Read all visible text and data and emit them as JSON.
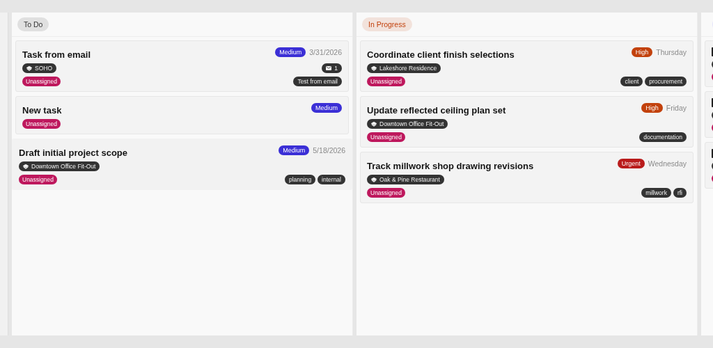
{
  "columns": [
    {
      "title": "To Do",
      "color": "#333333",
      "cards": [
        {
          "title": "Task from email",
          "hovered": false,
          "priority": {
            "label": "Medium",
            "color": "#3b2fd6"
          },
          "due": "3/31/2026",
          "project": "SOHO",
          "email_count": "1",
          "assignee": "Unassigned",
          "tags": [
            "Test from email"
          ]
        },
        {
          "title": "New task",
          "hovered": false,
          "priority": {
            "label": "Medium",
            "color": "#3b2fd6"
          },
          "assignee": "Unassigned"
        },
        {
          "title": "Draft initial project scope",
          "hovered": true,
          "priority": {
            "label": "Medium",
            "color": "#3b2fd6"
          },
          "due": "5/18/2026",
          "project": "Downtown Office Fit-Out",
          "assignee": "Unassigned",
          "tags": [
            "planning",
            "internal"
          ]
        }
      ]
    },
    {
      "title": "In Progress",
      "color": "#c2410c",
      "cards": [
        {
          "title": "Coordinate client finish selections",
          "hovered": false,
          "priority": {
            "label": "High",
            "color": "#c2410c"
          },
          "due": "Thursday",
          "project": "Lakeshore Residence",
          "assignee": "Unassigned",
          "tags": [
            "client",
            "procurement"
          ]
        },
        {
          "title": "Update reflected ceiling plan set",
          "hovered": false,
          "priority": {
            "label": "High",
            "color": "#c2410c"
          },
          "due": "Friday",
          "project": "Downtown Office Fit-Out",
          "assignee": "Unassigned",
          "tags": [
            "documentation"
          ]
        },
        {
          "title": "Track millwork shop drawing revisions",
          "hovered": false,
          "priority": {
            "label": "Urgent",
            "color": "#b91c1c"
          },
          "due": "Wednesday",
          "project": "Oak & Pine Restaurant",
          "assignee": "Unassigned",
          "tags": [
            "millwork",
            "rfi"
          ]
        }
      ]
    },
    {
      "color": "#e2e2fb",
      "kind": "partial",
      "cards": [
        {
          "hovered": false
        },
        {
          "hovered": false
        },
        {
          "hovered": false
        }
      ]
    }
  ]
}
